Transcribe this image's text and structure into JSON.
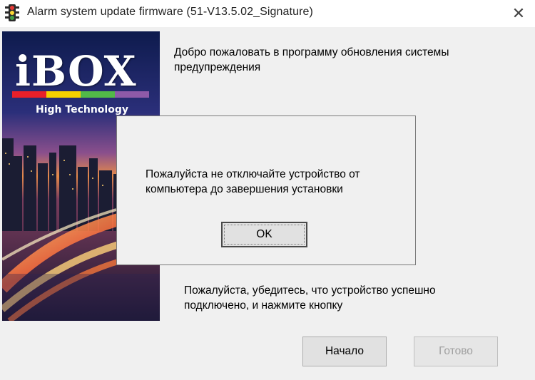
{
  "window": {
    "title": "Alarm system update firmware (51-V13.5.02_Signature)",
    "app_icon": "traffic-light-icon",
    "close_glyph": "✕"
  },
  "banner": {
    "brand": "iBOX",
    "tagline": "High Technology",
    "stripe_colors": [
      "#e8202a",
      "#f5d000",
      "#52b848",
      "#9b59b6",
      "#7d5ca8"
    ]
  },
  "main": {
    "welcome_text": "Добро пожаловать в программу обновления системы предупреждения",
    "instruction_text": "Пожалуйста, убедитесь, что устройство успешно подключено, и нажмите кнопку",
    "start_button": "Начало",
    "done_button": "Готово"
  },
  "dialog": {
    "message": "Пожалуйста не отключайте устройство от компьютера до завершения установки",
    "ok_button": "OK"
  }
}
